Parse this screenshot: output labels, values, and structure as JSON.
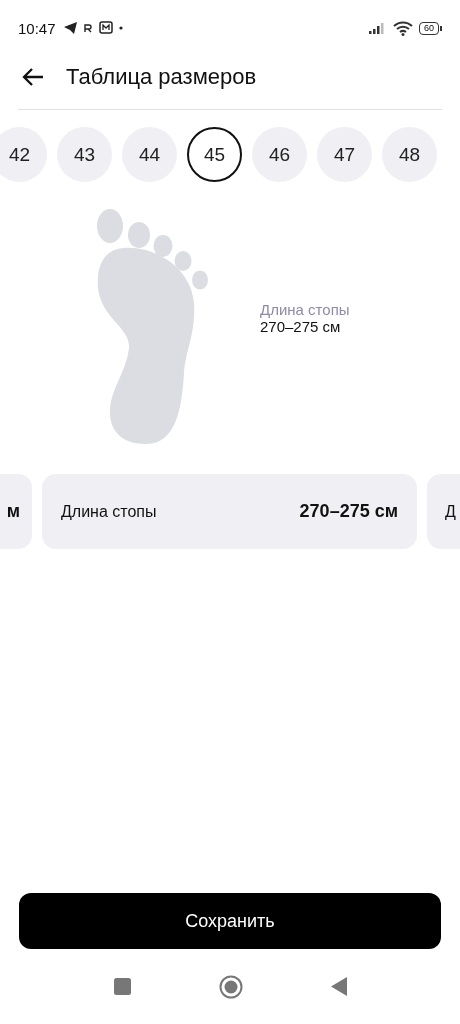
{
  "status_bar": {
    "time": "10:47",
    "battery": "60"
  },
  "header": {
    "title": "Таблица размеров"
  },
  "sizes": [
    {
      "label": "42",
      "selected": false
    },
    {
      "label": "43",
      "selected": false
    },
    {
      "label": "44",
      "selected": false
    },
    {
      "label": "45",
      "selected": true
    },
    {
      "label": "46",
      "selected": false
    },
    {
      "label": "47",
      "selected": false
    },
    {
      "label": "48",
      "selected": false
    }
  ],
  "foot": {
    "label": "Длина стопы",
    "value": "270–275 см"
  },
  "cards": [
    {
      "kind": "partial-left",
      "value": "м"
    },
    {
      "kind": "full",
      "label": "Длина стопы",
      "value": "270–275 см"
    },
    {
      "kind": "partial-right",
      "label": "Д"
    }
  ],
  "save_button": "Сохранить"
}
